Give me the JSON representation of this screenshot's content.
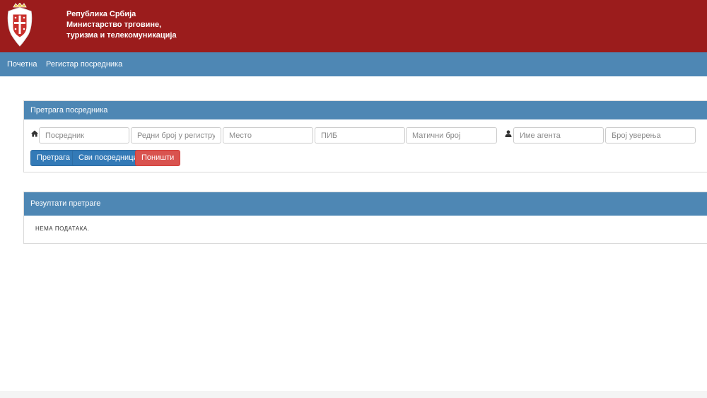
{
  "header": {
    "republic": "Република Србија",
    "ministry": "Министарство трговине, туризма и телекомуникација",
    "bg_color": "#9b1c1c"
  },
  "nav": {
    "home": "Почетна",
    "register": "Регистар посредника",
    "bg_color": "#4e87b4"
  },
  "search_panel": {
    "title": "Претрага посредника",
    "home_icon": "home-icon",
    "user_icon": "user-icon",
    "fields": {
      "intermediary": "Посредник",
      "register_number": "Редни број у регистру",
      "place": "Место",
      "pib": "ПИБ",
      "registry_number": "Матични број",
      "agent_name": "Име агента",
      "certificate_number": "Број уверења"
    },
    "buttons": {
      "search": "Претрага",
      "all": "Сви посредници",
      "reset": "Поништи"
    }
  },
  "results_panel": {
    "title": "Резултати претраге",
    "empty_message": "НЕМА ПОДАТАКА."
  }
}
